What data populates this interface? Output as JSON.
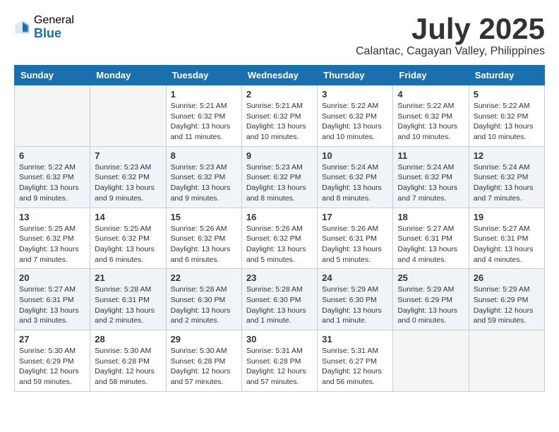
{
  "header": {
    "logo_general": "General",
    "logo_blue": "Blue",
    "month_title": "July 2025",
    "subtitle": "Calantac, Cagayan Valley, Philippines"
  },
  "calendar": {
    "days_of_week": [
      "Sunday",
      "Monday",
      "Tuesday",
      "Wednesday",
      "Thursday",
      "Friday",
      "Saturday"
    ],
    "weeks": [
      [
        {
          "num": "",
          "info": ""
        },
        {
          "num": "",
          "info": ""
        },
        {
          "num": "1",
          "info": "Sunrise: 5:21 AM\nSunset: 6:32 PM\nDaylight: 13 hours and 11 minutes."
        },
        {
          "num": "2",
          "info": "Sunrise: 5:21 AM\nSunset: 6:32 PM\nDaylight: 13 hours and 10 minutes."
        },
        {
          "num": "3",
          "info": "Sunrise: 5:22 AM\nSunset: 6:32 PM\nDaylight: 13 hours and 10 minutes."
        },
        {
          "num": "4",
          "info": "Sunrise: 5:22 AM\nSunset: 6:32 PM\nDaylight: 13 hours and 10 minutes."
        },
        {
          "num": "5",
          "info": "Sunrise: 5:22 AM\nSunset: 6:32 PM\nDaylight: 13 hours and 10 minutes."
        }
      ],
      [
        {
          "num": "6",
          "info": "Sunrise: 5:22 AM\nSunset: 6:32 PM\nDaylight: 13 hours and 9 minutes."
        },
        {
          "num": "7",
          "info": "Sunrise: 5:23 AM\nSunset: 6:32 PM\nDaylight: 13 hours and 9 minutes."
        },
        {
          "num": "8",
          "info": "Sunrise: 5:23 AM\nSunset: 6:32 PM\nDaylight: 13 hours and 9 minutes."
        },
        {
          "num": "9",
          "info": "Sunrise: 5:23 AM\nSunset: 6:32 PM\nDaylight: 13 hours and 8 minutes."
        },
        {
          "num": "10",
          "info": "Sunrise: 5:24 AM\nSunset: 6:32 PM\nDaylight: 13 hours and 8 minutes."
        },
        {
          "num": "11",
          "info": "Sunrise: 5:24 AM\nSunset: 6:32 PM\nDaylight: 13 hours and 7 minutes."
        },
        {
          "num": "12",
          "info": "Sunrise: 5:24 AM\nSunset: 6:32 PM\nDaylight: 13 hours and 7 minutes."
        }
      ],
      [
        {
          "num": "13",
          "info": "Sunrise: 5:25 AM\nSunset: 6:32 PM\nDaylight: 13 hours and 7 minutes."
        },
        {
          "num": "14",
          "info": "Sunrise: 5:25 AM\nSunset: 6:32 PM\nDaylight: 13 hours and 6 minutes."
        },
        {
          "num": "15",
          "info": "Sunrise: 5:26 AM\nSunset: 6:32 PM\nDaylight: 13 hours and 6 minutes."
        },
        {
          "num": "16",
          "info": "Sunrise: 5:26 AM\nSunset: 6:32 PM\nDaylight: 13 hours and 5 minutes."
        },
        {
          "num": "17",
          "info": "Sunrise: 5:26 AM\nSunset: 6:31 PM\nDaylight: 13 hours and 5 minutes."
        },
        {
          "num": "18",
          "info": "Sunrise: 5:27 AM\nSunset: 6:31 PM\nDaylight: 13 hours and 4 minutes."
        },
        {
          "num": "19",
          "info": "Sunrise: 5:27 AM\nSunset: 6:31 PM\nDaylight: 13 hours and 4 minutes."
        }
      ],
      [
        {
          "num": "20",
          "info": "Sunrise: 5:27 AM\nSunset: 6:31 PM\nDaylight: 13 hours and 3 minutes."
        },
        {
          "num": "21",
          "info": "Sunrise: 5:28 AM\nSunset: 6:31 PM\nDaylight: 13 hours and 2 minutes."
        },
        {
          "num": "22",
          "info": "Sunrise: 5:28 AM\nSunset: 6:30 PM\nDaylight: 13 hours and 2 minutes."
        },
        {
          "num": "23",
          "info": "Sunrise: 5:28 AM\nSunset: 6:30 PM\nDaylight: 13 hours and 1 minute."
        },
        {
          "num": "24",
          "info": "Sunrise: 5:29 AM\nSunset: 6:30 PM\nDaylight: 13 hours and 1 minute."
        },
        {
          "num": "25",
          "info": "Sunrise: 5:29 AM\nSunset: 6:29 PM\nDaylight: 13 hours and 0 minutes."
        },
        {
          "num": "26",
          "info": "Sunrise: 5:29 AM\nSunset: 6:29 PM\nDaylight: 12 hours and 59 minutes."
        }
      ],
      [
        {
          "num": "27",
          "info": "Sunrise: 5:30 AM\nSunset: 6:29 PM\nDaylight: 12 hours and 59 minutes."
        },
        {
          "num": "28",
          "info": "Sunrise: 5:30 AM\nSunset: 6:28 PM\nDaylight: 12 hours and 58 minutes."
        },
        {
          "num": "29",
          "info": "Sunrise: 5:30 AM\nSunset: 6:28 PM\nDaylight: 12 hours and 57 minutes."
        },
        {
          "num": "30",
          "info": "Sunrise: 5:31 AM\nSunset: 6:28 PM\nDaylight: 12 hours and 57 minutes."
        },
        {
          "num": "31",
          "info": "Sunrise: 5:31 AM\nSunset: 6:27 PM\nDaylight: 12 hours and 56 minutes."
        },
        {
          "num": "",
          "info": ""
        },
        {
          "num": "",
          "info": ""
        }
      ]
    ]
  }
}
